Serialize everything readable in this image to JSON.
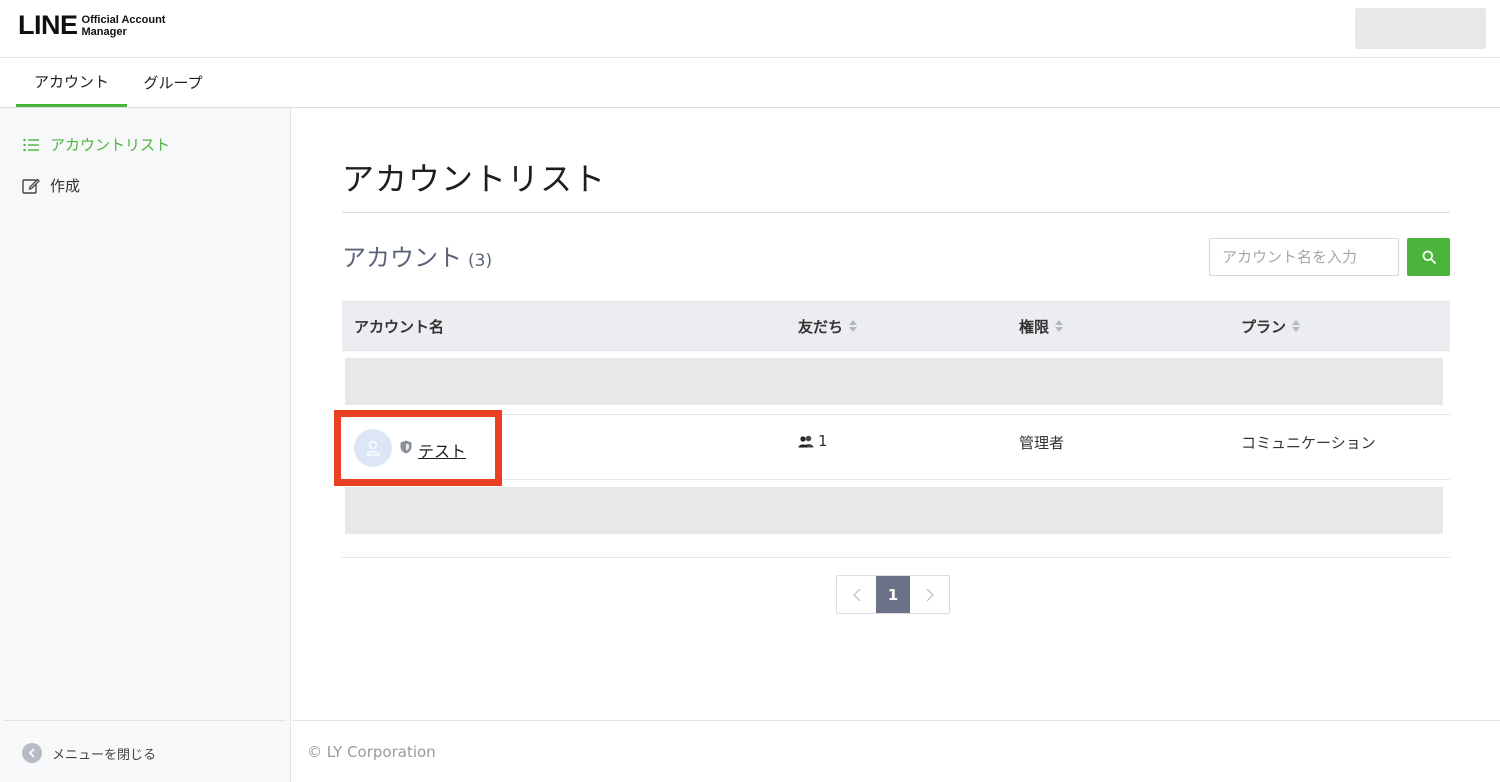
{
  "header": {
    "logo_main": "LINE",
    "logo_sub_line1": "Official Account",
    "logo_sub_line2": "Manager"
  },
  "tabs": [
    {
      "label": "アカウント",
      "active": true
    },
    {
      "label": "グループ",
      "active": false
    }
  ],
  "sidebar": {
    "items": [
      {
        "label": "アカウントリスト",
        "icon": "list-icon",
        "active": true
      },
      {
        "label": "作成",
        "icon": "edit-icon",
        "active": false
      }
    ],
    "close_label": "メニューを閉じる"
  },
  "main": {
    "page_title": "アカウントリスト",
    "section_title": "アカウント",
    "section_count": "(3)",
    "search_placeholder": "アカウント名を入力"
  },
  "table": {
    "columns": [
      "アカウント名",
      "友だち",
      "権限",
      "プラン"
    ],
    "rows": [
      {
        "name": "テスト",
        "friends": "1",
        "role": "管理者",
        "plan": "コミュニケーション"
      }
    ]
  },
  "pagination": {
    "current": "1"
  },
  "footer": {
    "copyright": "© LY Corporation"
  },
  "colors": {
    "accent": "#4cb43c",
    "highlight": "#ea3f25",
    "pager_active": "#6b7287"
  }
}
